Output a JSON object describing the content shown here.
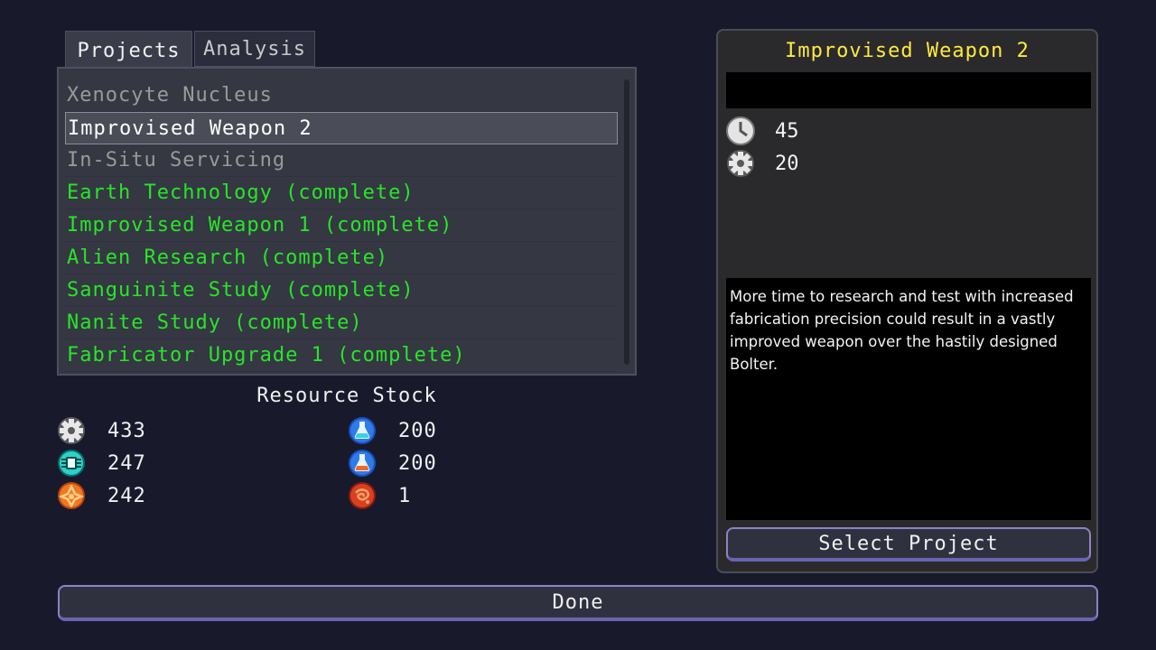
{
  "tabs": [
    {
      "label": "Projects",
      "active": true
    },
    {
      "label": "Analysis",
      "active": false
    }
  ],
  "projects": [
    {
      "label": "Xenocyte Nucleus",
      "state": "locked"
    },
    {
      "label": "Improvised Weapon 2",
      "state": "selected"
    },
    {
      "label": "In-Situ Servicing",
      "state": "locked"
    },
    {
      "label": "Earth Technology (complete)",
      "state": "complete"
    },
    {
      "label": "Improvised Weapon 1 (complete)",
      "state": "complete"
    },
    {
      "label": "Alien Research (complete)",
      "state": "complete"
    },
    {
      "label": "Sanguinite Study (complete)",
      "state": "complete"
    },
    {
      "label": "Nanite Study (complete)",
      "state": "complete"
    },
    {
      "label": "Fabricator Upgrade 1 (complete)",
      "state": "complete"
    }
  ],
  "resources": {
    "title": "Resource Stock",
    "items": [
      {
        "icon": "gear-icon",
        "value": "433"
      },
      {
        "icon": "chip-icon",
        "value": "247"
      },
      {
        "icon": "ore-icon",
        "value": "242"
      },
      {
        "icon": "flask-blue-icon",
        "value": "200"
      },
      {
        "icon": "flask-orange-icon",
        "value": "200"
      },
      {
        "icon": "sanguinite-icon",
        "value": "1"
      }
    ]
  },
  "detail": {
    "title": "Improvised Weapon 2",
    "time_cost": "45",
    "parts_cost": "20",
    "description": "More time to research and test with increased fabrication precision could result in a vastly improved weapon over the hastily designed Bolter.",
    "select_label": "Select Project"
  },
  "done_label": "Done",
  "colors": {
    "background": "#181a2c",
    "complete": "#27e627",
    "title": "#ffe940",
    "button_border": "#8d82c8"
  }
}
